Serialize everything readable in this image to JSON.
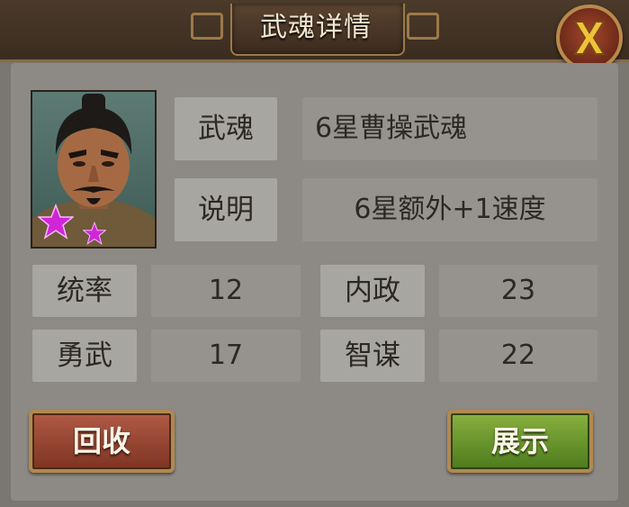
{
  "dialog": {
    "title": "武魂详情",
    "close_icon": "close-x-icon"
  },
  "soul": {
    "name_label": "武魂",
    "name_value": "6星曹操武魂",
    "desc_label": "说明",
    "desc_value": "6星额外+1速度",
    "star_count": 2,
    "star_color": "#d026d8"
  },
  "stats": [
    {
      "label": "统率",
      "value": "12"
    },
    {
      "label": "内政",
      "value": "23"
    },
    {
      "label": "勇武",
      "value": "17"
    },
    {
      "label": "智谋",
      "value": "22"
    }
  ],
  "buttons": {
    "recycle_label": "回收",
    "show_label": "展示"
  },
  "colors": {
    "header": "#3a2c20",
    "gold_trim": "#9c7a48",
    "close_x": "#f0c23a",
    "recycle_btn": "#9a4632",
    "show_btn": "#6b9a2e"
  }
}
